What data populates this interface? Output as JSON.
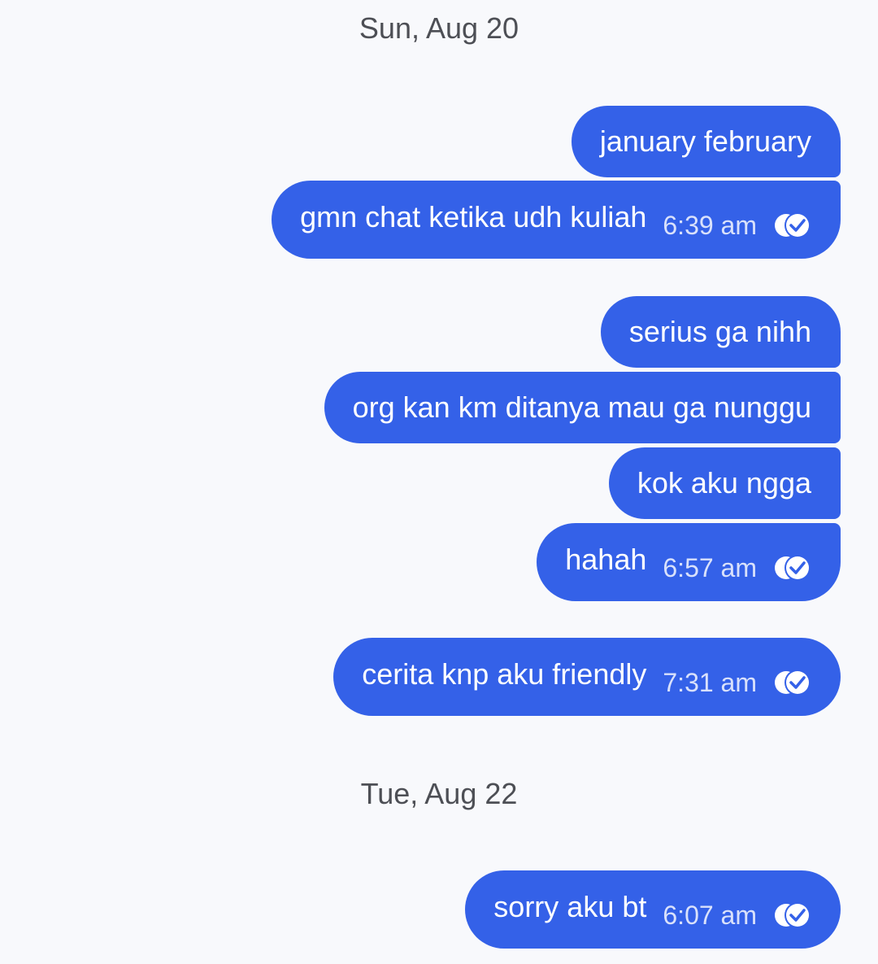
{
  "dates": [
    "Sun, Aug 20",
    "Tue, Aug 22"
  ],
  "messages": [
    {
      "text": "january february"
    },
    {
      "text": "gmn chat ketika udh kuliah",
      "time": "6:39 am",
      "status": "read-double-check-icon"
    },
    {
      "text": "serius ga nihh"
    },
    {
      "text": "org kan km ditanya mau ga nunggu"
    },
    {
      "text": "kok aku ngga"
    },
    {
      "text": "hahah",
      "time": "6:57 am",
      "status": "read-double-check-icon"
    },
    {
      "text": "cerita knp aku friendly",
      "time": "7:31 am",
      "status": "read-double-check-icon"
    },
    {
      "text": "sorry aku bt",
      "time": "6:07 am",
      "status": "read-double-check-icon"
    }
  ],
  "colors": {
    "background": "#f8f9fc",
    "bubble": "#3461e8",
    "bubble_text": "#ffffff",
    "time_text": "#d9e1fb",
    "date_text": "#4d4f55"
  }
}
